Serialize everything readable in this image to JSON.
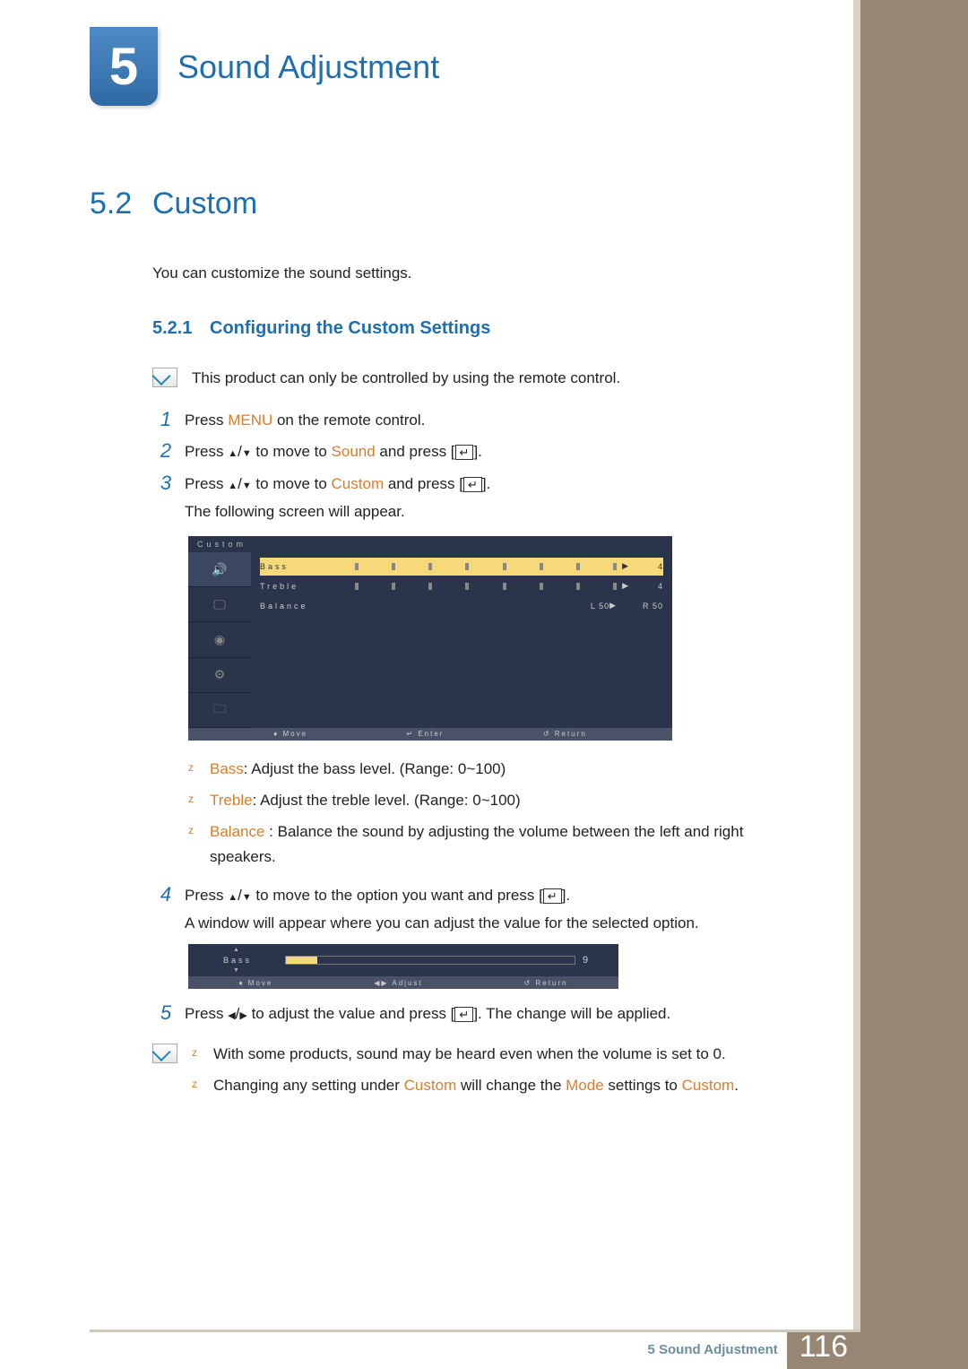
{
  "chapter": {
    "number": "5",
    "title": "Sound Adjustment"
  },
  "section": {
    "number": "5.2",
    "title": "Custom"
  },
  "intro": "You can customize the sound settings.",
  "subsection": {
    "number": "5.2.1",
    "title": "Configuring the Custom Settings"
  },
  "note1": "This product can only be controlled by using the remote control.",
  "steps": {
    "s1": {
      "num": "1",
      "pre": "Press ",
      "hl": "MENU",
      "post": " on the remote control."
    },
    "s2": {
      "num": "2",
      "pre": "Press ",
      "mid": " to move to ",
      "hl": "Sound",
      "post": " and press [",
      "tail": "]."
    },
    "s3": {
      "num": "3",
      "pre": "Press ",
      "mid": " to move to ",
      "hl": "Custom",
      "post": " and press [",
      "tail": "].",
      "sub": "The following screen will appear."
    },
    "s4": {
      "num": "4",
      "pre": "Press ",
      "mid": " to move to the option you want and press [",
      "tail": "].",
      "sub": "A window will appear where you can adjust the value for the selected option."
    },
    "s5": {
      "num": "5",
      "pre": "Press ",
      "mid": " to adjust the value and press [",
      "tail": "]. The change will be applied."
    }
  },
  "bullets": {
    "bass": {
      "label": "Bass",
      "text": ": Adjust the bass level. (Range: 0~100)"
    },
    "treble": {
      "label": "Treble",
      "text": ": Adjust the treble level. (Range: 0~100)"
    },
    "balance": {
      "label": "Balance ",
      "text": ": Balance the sound by adjusting the volume between the left and right speakers."
    }
  },
  "note2": {
    "line1": "With some products, sound may be heard even when the volume is set to 0.",
    "line2_pre": "Changing any setting under ",
    "line2_hl1": "Custom",
    "line2_mid": " will change the ",
    "line2_hl2": "Mode",
    "line2_mid2": " settings to ",
    "line2_hl3": "Custom",
    "line2_post": "."
  },
  "osd": {
    "title": "Custom",
    "bass_label": "Bass",
    "bass_value": "4",
    "treble_label": "Treble",
    "treble_value": "4",
    "balance_label": "Balance",
    "balance_l": "L  50",
    "balance_r": "R  50",
    "footer_move": "Move",
    "footer_enter": "Enter",
    "footer_return": "Return"
  },
  "osd2": {
    "label": "Bass",
    "value": "9",
    "footer_move": "Move",
    "footer_adjust": "Adjust",
    "footer_return": "Return"
  },
  "footer": {
    "chapter": "5",
    "title": "Sound Adjustment",
    "page": "116"
  }
}
